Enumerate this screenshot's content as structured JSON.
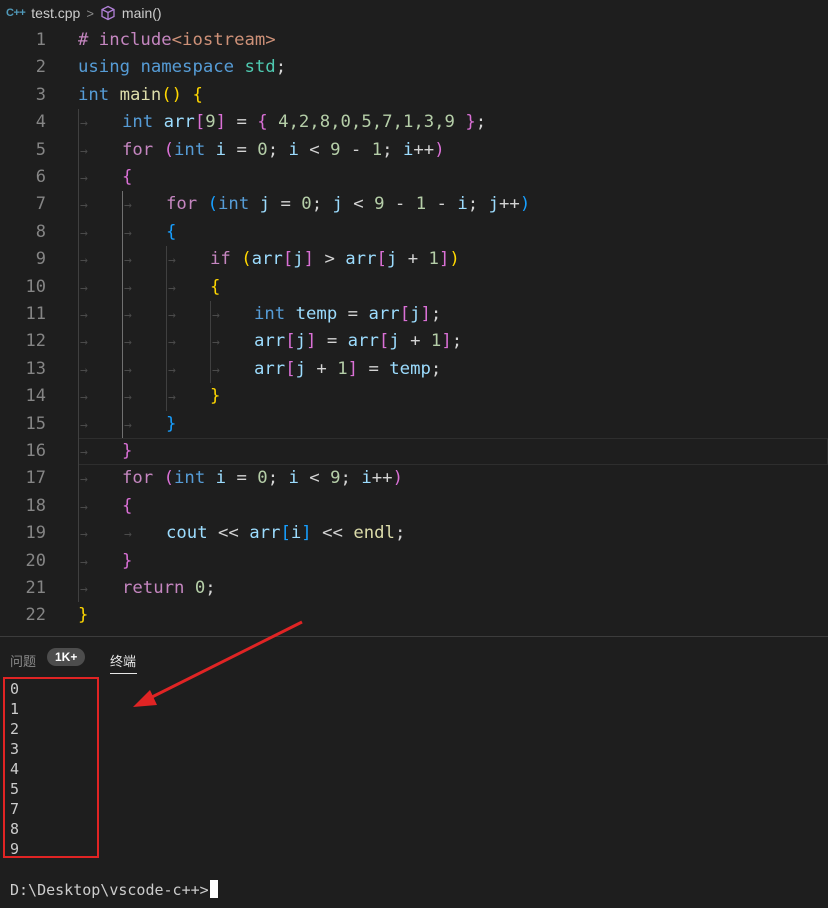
{
  "breadcrumb": {
    "file_icon": "C++",
    "file": "test.cpp",
    "separator": ">",
    "symbol": "main()"
  },
  "code_lines": [
    {
      "n": "1",
      "tokens": [
        [
          "ctl",
          "# include"
        ],
        [
          "str",
          "<iostream>"
        ]
      ]
    },
    {
      "n": "2",
      "tokens": [
        [
          "kw",
          "using"
        ],
        [
          "pun",
          " "
        ],
        [
          "kw",
          "namespace"
        ],
        [
          "pun",
          " "
        ],
        [
          "ns",
          "std"
        ],
        [
          "pun",
          ";"
        ]
      ]
    },
    {
      "n": "3",
      "tokens": [
        [
          "kw",
          "int"
        ],
        [
          "pun",
          " "
        ],
        [
          "fn",
          "main"
        ],
        [
          "brk",
          "()"
        ],
        [
          "pun",
          " "
        ],
        [
          "brk",
          "{"
        ]
      ]
    },
    {
      "n": "4",
      "tokens": [
        [
          "kw",
          "int"
        ],
        [
          "pun",
          " "
        ],
        [
          "var",
          "arr"
        ],
        [
          "brk2",
          "["
        ],
        [
          "num",
          "9"
        ],
        [
          "brk2",
          "]"
        ],
        [
          "pun",
          " = "
        ],
        [
          "brk2",
          "{"
        ],
        [
          "pun",
          " "
        ],
        [
          "num",
          "4,2,8,0,5,7,1,3,9"
        ],
        [
          "pun",
          " "
        ],
        [
          "brk2",
          "}"
        ],
        [
          "pun",
          ";"
        ]
      ]
    },
    {
      "n": "5",
      "tokens": [
        [
          "ctl",
          "for"
        ],
        [
          "pun",
          " "
        ],
        [
          "brk2",
          "("
        ],
        [
          "kw",
          "int"
        ],
        [
          "pun",
          " "
        ],
        [
          "var",
          "i"
        ],
        [
          "pun",
          " = "
        ],
        [
          "num",
          "0"
        ],
        [
          "pun",
          "; "
        ],
        [
          "var",
          "i"
        ],
        [
          "pun",
          " < "
        ],
        [
          "num",
          "9"
        ],
        [
          "pun",
          " - "
        ],
        [
          "num",
          "1"
        ],
        [
          "pun",
          "; "
        ],
        [
          "var",
          "i"
        ],
        [
          "pun",
          "++"
        ],
        [
          "brk2",
          ")"
        ]
      ]
    },
    {
      "n": "6",
      "tokens": [
        [
          "brk2",
          "{"
        ]
      ]
    },
    {
      "n": "7",
      "tokens": [
        [
          "ctl",
          "for"
        ],
        [
          "pun",
          " "
        ],
        [
          "brk3",
          "("
        ],
        [
          "kw",
          "int"
        ],
        [
          "pun",
          " "
        ],
        [
          "var",
          "j"
        ],
        [
          "pun",
          " = "
        ],
        [
          "num",
          "0"
        ],
        [
          "pun",
          "; "
        ],
        [
          "var",
          "j"
        ],
        [
          "pun",
          " < "
        ],
        [
          "num",
          "9"
        ],
        [
          "pun",
          " - "
        ],
        [
          "num",
          "1"
        ],
        [
          "pun",
          " - "
        ],
        [
          "var",
          "i"
        ],
        [
          "pun",
          "; "
        ],
        [
          "var",
          "j"
        ],
        [
          "pun",
          "++"
        ],
        [
          "brk3",
          ")"
        ]
      ]
    },
    {
      "n": "8",
      "tokens": [
        [
          "brk3",
          "{"
        ]
      ]
    },
    {
      "n": "9",
      "tokens": [
        [
          "ctl",
          "if"
        ],
        [
          "pun",
          " "
        ],
        [
          "brk",
          "("
        ],
        [
          "var",
          "arr"
        ],
        [
          "brk2",
          "["
        ],
        [
          "var",
          "j"
        ],
        [
          "brk2",
          "]"
        ],
        [
          "pun",
          " > "
        ],
        [
          "var",
          "arr"
        ],
        [
          "brk2",
          "["
        ],
        [
          "var",
          "j"
        ],
        [
          "pun",
          " + "
        ],
        [
          "num",
          "1"
        ],
        [
          "brk2",
          "]"
        ],
        [
          "brk",
          ")"
        ]
      ]
    },
    {
      "n": "10",
      "tokens": [
        [
          "brk",
          "{"
        ]
      ]
    },
    {
      "n": "11",
      "tokens": [
        [
          "kw",
          "int"
        ],
        [
          "pun",
          " "
        ],
        [
          "var",
          "temp"
        ],
        [
          "pun",
          " = "
        ],
        [
          "var",
          "arr"
        ],
        [
          "brk2",
          "["
        ],
        [
          "var",
          "j"
        ],
        [
          "brk2",
          "]"
        ],
        [
          "pun",
          ";"
        ]
      ]
    },
    {
      "n": "12",
      "tokens": [
        [
          "var",
          "arr"
        ],
        [
          "brk2",
          "["
        ],
        [
          "var",
          "j"
        ],
        [
          "brk2",
          "]"
        ],
        [
          "pun",
          " = "
        ],
        [
          "var",
          "arr"
        ],
        [
          "brk2",
          "["
        ],
        [
          "var",
          "j"
        ],
        [
          "pun",
          " + "
        ],
        [
          "num",
          "1"
        ],
        [
          "brk2",
          "]"
        ],
        [
          "pun",
          ";"
        ]
      ]
    },
    {
      "n": "13",
      "tokens": [
        [
          "var",
          "arr"
        ],
        [
          "brk2",
          "["
        ],
        [
          "var",
          "j"
        ],
        [
          "pun",
          " + "
        ],
        [
          "num",
          "1"
        ],
        [
          "brk2",
          "]"
        ],
        [
          "pun",
          " = "
        ],
        [
          "var",
          "temp"
        ],
        [
          "pun",
          ";"
        ]
      ]
    },
    {
      "n": "14",
      "tokens": [
        [
          "brk",
          "}"
        ]
      ]
    },
    {
      "n": "15",
      "tokens": [
        [
          "brk3",
          "}"
        ]
      ]
    },
    {
      "n": "16",
      "tokens": [
        [
          "brk2",
          "}"
        ]
      ]
    },
    {
      "n": "17",
      "tokens": [
        [
          "ctl",
          "for"
        ],
        [
          "pun",
          " "
        ],
        [
          "brk2",
          "("
        ],
        [
          "kw",
          "int"
        ],
        [
          "pun",
          " "
        ],
        [
          "var",
          "i"
        ],
        [
          "pun",
          " = "
        ],
        [
          "num",
          "0"
        ],
        [
          "pun",
          "; "
        ],
        [
          "var",
          "i"
        ],
        [
          "pun",
          " < "
        ],
        [
          "num",
          "9"
        ],
        [
          "pun",
          "; "
        ],
        [
          "var",
          "i"
        ],
        [
          "pun",
          "++"
        ],
        [
          "brk2",
          ")"
        ]
      ]
    },
    {
      "n": "18",
      "tokens": [
        [
          "brk2",
          "{"
        ]
      ]
    },
    {
      "n": "19",
      "tokens": [
        [
          "var",
          "cout"
        ],
        [
          "pun",
          " << "
        ],
        [
          "var",
          "arr"
        ],
        [
          "brk3",
          "["
        ],
        [
          "var",
          "i"
        ],
        [
          "brk3",
          "]"
        ],
        [
          "pun",
          " << "
        ],
        [
          "fn",
          "endl"
        ],
        [
          "pun",
          ";"
        ]
      ]
    },
    {
      "n": "20",
      "tokens": [
        [
          "brk2",
          "}"
        ]
      ]
    },
    {
      "n": "21",
      "tokens": [
        [
          "ctl",
          "return"
        ],
        [
          "pun",
          " "
        ],
        [
          "num",
          "0"
        ],
        [
          "pun",
          ";"
        ]
      ]
    },
    {
      "n": "22",
      "tokens": [
        [
          "brk",
          "}"
        ]
      ]
    }
  ],
  "panel": {
    "problems_label": "问题",
    "problems_badge": "1K+",
    "terminal_label": "终端"
  },
  "terminal": {
    "output": [
      "0",
      "1",
      "2",
      "3",
      "4",
      "5",
      "7",
      "8",
      "9"
    ],
    "prompt": "D:\\Desktop\\vscode-c++>"
  },
  "colors": {
    "background": "#1e1e1e",
    "annotation_red": "#e02424"
  }
}
